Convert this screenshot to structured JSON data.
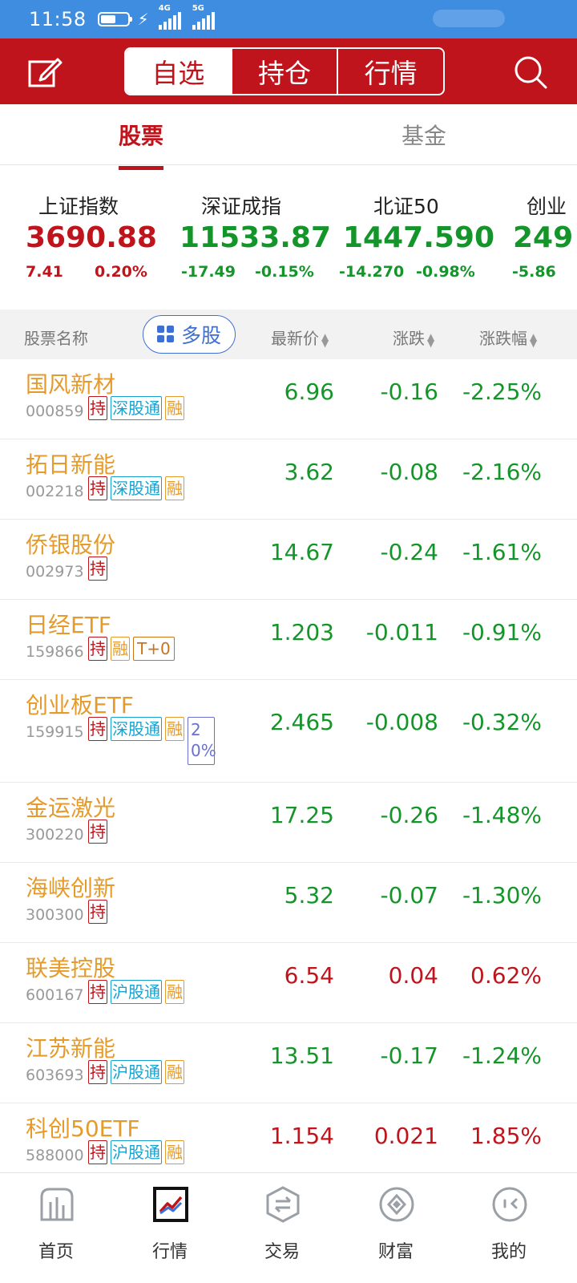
{
  "status": {
    "time": "11:58",
    "net1": "4G",
    "net2": "5G"
  },
  "header": {
    "tabs": [
      {
        "label": "自选",
        "active": true
      },
      {
        "label": "持仓",
        "active": false
      },
      {
        "label": "行情",
        "active": false
      }
    ]
  },
  "subtabs": [
    {
      "label": "股票",
      "active": true
    },
    {
      "label": "基金",
      "active": false
    }
  ],
  "indices": [
    {
      "name": "上证指数",
      "value": "3690.88",
      "change": "7.41",
      "percent": "0.20%",
      "trend": "up"
    },
    {
      "name": "深证成指",
      "value": "11533.87",
      "change": "-17.49",
      "percent": "-0.15%",
      "trend": "down"
    },
    {
      "name": "北证50",
      "value": "1447.590",
      "change": "-14.270",
      "percent": "-0.98%",
      "trend": "down"
    },
    {
      "name": "创业",
      "value": "249",
      "change": "-5.86",
      "percent": "",
      "trend": "down"
    }
  ],
  "table": {
    "col_name": "股票名称",
    "multi_label": "多股",
    "col_price": "最新价",
    "col_change": "涨跌",
    "col_percent": "涨跌幅"
  },
  "stocks": [
    {
      "name": "国风新材",
      "code": "000859",
      "badges": [
        "持",
        "深股通",
        "融"
      ],
      "price": "6.96",
      "change": "-0.16",
      "percent": "-2.25%",
      "trend": "down"
    },
    {
      "name": "拓日新能",
      "code": "002218",
      "badges": [
        "持",
        "深股通",
        "融"
      ],
      "price": "3.62",
      "change": "-0.08",
      "percent": "-2.16%",
      "trend": "down"
    },
    {
      "name": "侨银股份",
      "code": "002973",
      "badges": [
        "持"
      ],
      "price": "14.67",
      "change": "-0.24",
      "percent": "-1.61%",
      "trend": "down"
    },
    {
      "name": "日经ETF",
      "code": "159866",
      "badges": [
        "持",
        "融",
        "T+0"
      ],
      "price": "1.203",
      "change": "-0.011",
      "percent": "-0.91%",
      "trend": "down"
    },
    {
      "name": "创业板ETF",
      "code": "159915",
      "badges": [
        "持",
        "深股通",
        "融",
        "20%"
      ],
      "price": "2.465",
      "change": "-0.008",
      "percent": "-0.32%",
      "trend": "down",
      "tall": true
    },
    {
      "name": "金运激光",
      "code": "300220",
      "badges": [
        "持"
      ],
      "price": "17.25",
      "change": "-0.26",
      "percent": "-1.48%",
      "trend": "down"
    },
    {
      "name": "海峡创新",
      "code": "300300",
      "badges": [
        "持"
      ],
      "price": "5.32",
      "change": "-0.07",
      "percent": "-1.30%",
      "trend": "down"
    },
    {
      "name": "联美控股",
      "code": "600167",
      "badges": [
        "持",
        "沪股通",
        "融"
      ],
      "price": "6.54",
      "change": "0.04",
      "percent": "0.62%",
      "trend": "up"
    },
    {
      "name": "江苏新能",
      "code": "603693",
      "badges": [
        "持",
        "沪股通",
        "融"
      ],
      "price": "13.51",
      "change": "-0.17",
      "percent": "-1.24%",
      "trend": "down"
    },
    {
      "name": "科创50ETF",
      "code": "588000",
      "badges": [
        "持",
        "沪股通",
        "融"
      ],
      "price": "1.154",
      "change": "0.021",
      "percent": "1.85%",
      "trend": "up"
    }
  ],
  "nav": [
    {
      "label": "首页",
      "icon": "home-chart-icon"
    },
    {
      "label": "行情",
      "icon": "market-trend-icon",
      "active": true
    },
    {
      "label": "交易",
      "icon": "trade-exchange-icon"
    },
    {
      "label": "财富",
      "icon": "wealth-diamond-icon"
    },
    {
      "label": "我的",
      "icon": "profile-face-icon"
    }
  ],
  "colors": {
    "brand_red": "#c0141c",
    "rise": "#c0141c",
    "fall": "#14952a",
    "stock_name": "#e59b2c",
    "status_bar": "#3f8de0"
  }
}
